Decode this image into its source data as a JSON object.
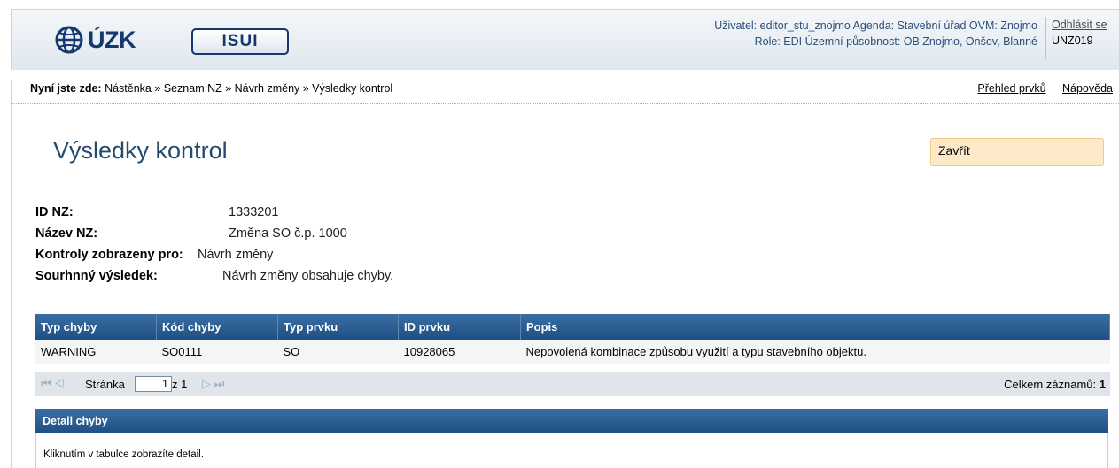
{
  "header": {
    "logo_cuzk": "ÚZK",
    "logo_isui": "ISUI",
    "user_line1": "Uživatel: editor_stu_znojmo   Agenda: Stavební úřad   OVM: Znojmo",
    "user_line2": "Role: EDI   Územní působnost: OB Znojmo, Onšov, Blanné",
    "logout": "Odhlásit se",
    "code": "UNZ019"
  },
  "breadcrumb": {
    "label": "Nyní jste zde:",
    "path": "Nástěnka » Seznam NZ » Návrh změny » Výsledky kontrol",
    "links": [
      "Přehled prvků",
      "Nápověda"
    ]
  },
  "page": {
    "title": "Výsledky kontrol",
    "close": "Zavřít"
  },
  "info": [
    {
      "k": "ID NZ:",
      "v": "1333201"
    },
    {
      "k": "Název NZ:",
      "v": "Změna SO č.p. 1000"
    },
    {
      "k": "Kontroly zobrazeny pro:",
      "v": "Návrh změny"
    },
    {
      "k": "Sourhnný výsledek:",
      "v": "Návrh změny obsahuje chyby."
    }
  ],
  "table": {
    "headers": [
      "Typ chyby",
      "Kód chyby",
      "Typ prvku",
      "ID prvku",
      "Popis"
    ],
    "rows": [
      [
        "WARNING",
        "SO0111",
        "SO",
        "10928065",
        "Nepovolená kombinace způsobu využití a typu stavebního objektu."
      ]
    ]
  },
  "pager": {
    "nav_first_prev": "⏮ ◁",
    "page_label": "Stránka",
    "page_value": "1",
    "of_label": "z 1",
    "nav_next_last": "▷ ⏭",
    "total_label": "Celkem záznamů:",
    "total_value": "1"
  },
  "detail": {
    "title": "Detail chyby",
    "text": "Kliknutím v tabulce zobrazíte detail."
  },
  "colors": {
    "header_blue": "#1f4f83",
    "title_blue": "#264a6e",
    "close_bg": "#fde8c8"
  }
}
